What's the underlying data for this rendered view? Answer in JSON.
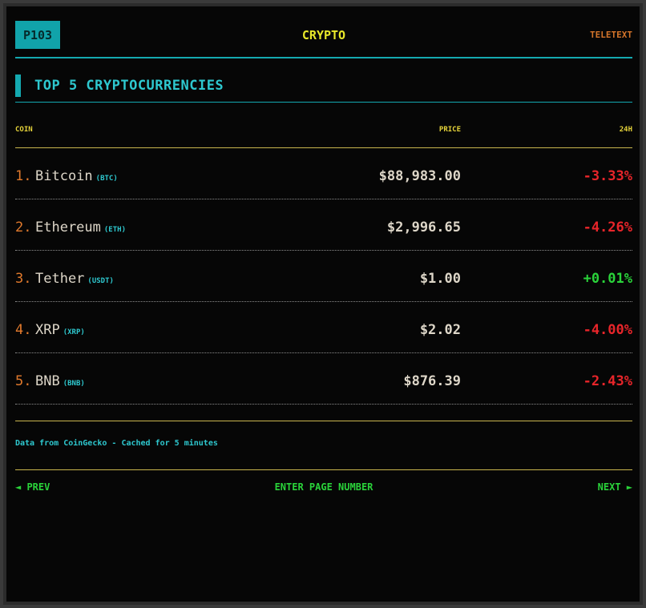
{
  "header": {
    "page_number": "P103",
    "brand": "CRYPTO",
    "service": "TELETEXT"
  },
  "section": {
    "title": "TOP 5 CRYPTOCURRENCIES"
  },
  "columns": {
    "coin": "COIN",
    "price": "PRICE",
    "change": "24H"
  },
  "rows": [
    {
      "rank": "1.",
      "name": "Bitcoin",
      "symbol": "(BTC)",
      "price": "$88,983.00",
      "change": "-3.33%",
      "trend": "neg"
    },
    {
      "rank": "2.",
      "name": "Ethereum",
      "symbol": "(ETH)",
      "price": "$2,996.65",
      "change": "-4.26%",
      "trend": "neg"
    },
    {
      "rank": "3.",
      "name": "Tether",
      "symbol": "(USDT)",
      "price": "$1.00",
      "change": "+0.01%",
      "trend": "pos"
    },
    {
      "rank": "4.",
      "name": "XRP",
      "symbol": "(XRP)",
      "price": "$2.02",
      "change": "-4.00%",
      "trend": "neg"
    },
    {
      "rank": "5.",
      "name": "BNB",
      "symbol": "(BNB)",
      "price": "$876.39",
      "change": "-2.43%",
      "trend": "neg"
    }
  ],
  "footer": {
    "note": "Data from CoinGecko - Cached for 5 minutes"
  },
  "nav": {
    "prev": "◄ PREV",
    "center": "ENTER PAGE NUMBER",
    "next": "NEXT ►"
  },
  "colors": {
    "cyan": "#14a9b0",
    "yellow": "#e8e82a",
    "orange": "#e0792c",
    "negative": "#e8252a",
    "positive": "#2ad33a"
  }
}
